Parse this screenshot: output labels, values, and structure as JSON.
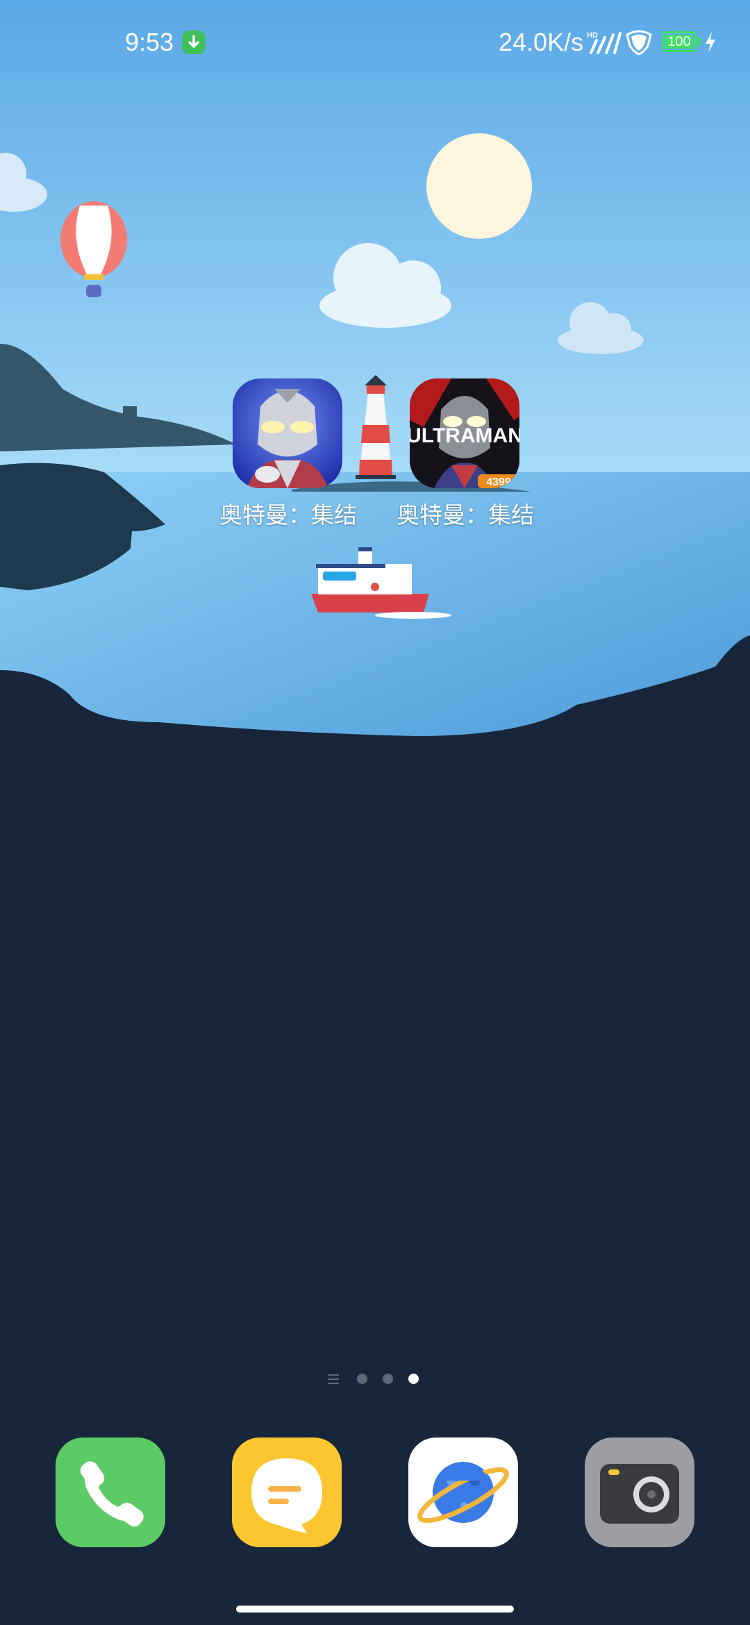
{
  "status_bar": {
    "time": "9:53",
    "network_speed": "24.0K/s",
    "signal_badge": "HD",
    "battery_level": "100",
    "charging": true
  },
  "home": {
    "apps": [
      {
        "label": "奥特曼：集结",
        "icon": "ultraman-tiga-game-icon"
      },
      {
        "label": "奥特曼：集结",
        "icon": "ultraman-assemble-4399-icon"
      }
    ],
    "app2_icon_text": {
      "brand": "ULTRAMAN",
      "badge": "4399"
    }
  },
  "page_indicator": {
    "total_pages": 3,
    "active_page": 3
  },
  "dock": {
    "apps": [
      {
        "icon": "phone-icon",
        "color": "#5ccb65"
      },
      {
        "icon": "messages-icon",
        "color": "#fbc62f"
      },
      {
        "icon": "browser-planet-icon",
        "color": "#ffffff"
      },
      {
        "icon": "camera-icon",
        "color": "#9c9ea3"
      }
    ]
  },
  "colors": {
    "sky_top": "#5aa8e6",
    "sea": "#7fc2ef",
    "land": "#17263a",
    "battery": "#3fe068"
  }
}
